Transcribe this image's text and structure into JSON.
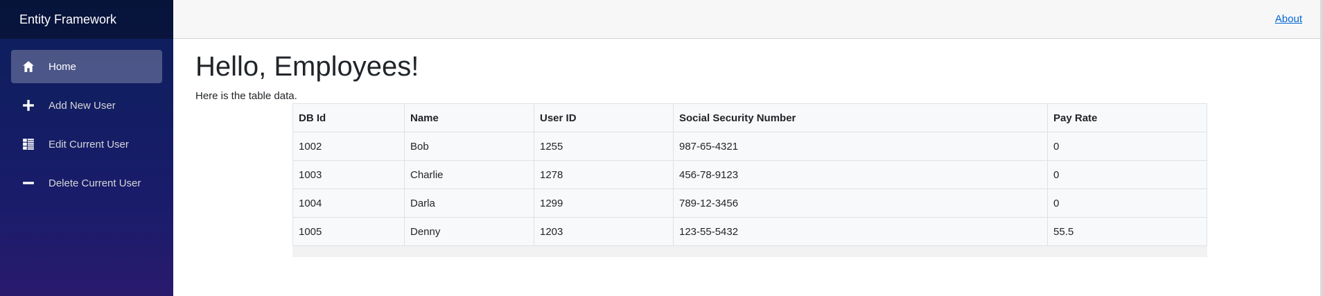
{
  "sidebar": {
    "brand": "Entity Framework",
    "items": [
      {
        "label": "Home",
        "icon": "home-icon",
        "active": true
      },
      {
        "label": "Add New User",
        "icon": "plus-icon",
        "active": false
      },
      {
        "label": "Edit Current User",
        "icon": "list-icon",
        "active": false
      },
      {
        "label": "Delete Current User",
        "icon": "minus-icon",
        "active": false
      }
    ]
  },
  "topbar": {
    "about_label": "About"
  },
  "main": {
    "title": "Hello, Employees!",
    "subtitle": "Here is the table data."
  },
  "table": {
    "headers": [
      "DB Id",
      "Name",
      "User ID",
      "Social Security Number",
      "Pay Rate"
    ],
    "rows": [
      [
        "1002",
        "Bob",
        "1255",
        "987-65-4321",
        "0"
      ],
      [
        "1003",
        "Charlie",
        "1278",
        "456-78-9123",
        "0"
      ],
      [
        "1004",
        "Darla",
        "1299",
        "789-12-3456",
        "0"
      ],
      [
        "1005",
        "Denny",
        "1203",
        "123-55-5432",
        "55.5"
      ]
    ]
  },
  "colors": {
    "sidebar_top": "#0b1f5a",
    "sidebar_bottom": "#2a1a6e",
    "link": "#0366d6"
  }
}
